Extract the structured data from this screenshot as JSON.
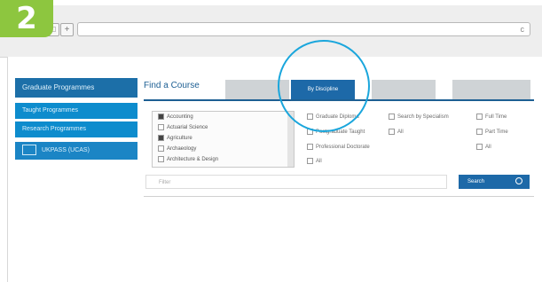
{
  "step": {
    "number": "2"
  },
  "browser": {
    "nav": [
      {
        "icon": "square-button-icon",
        "glyph": "□"
      },
      {
        "icon": "plus-icon",
        "glyph": "+"
      }
    ],
    "reload": {
      "icon": "reload-icon",
      "glyph": "c"
    }
  },
  "sidebar": {
    "header": "Graduate Programmes",
    "items": [
      "Taught Programmes",
      "Research Programmes"
    ],
    "ucas": {
      "label": "UKPASS (UCAS)",
      "icon": "ucas-logo-icon"
    }
  },
  "finder": {
    "title": "Find a Course",
    "tabs": [
      {
        "label": "",
        "active": false
      },
      {
        "label": "By Discipline",
        "active": true
      },
      {
        "label": "",
        "active": false
      },
      {
        "label": "",
        "active": false
      }
    ],
    "subjects": [
      {
        "label": "Accounting",
        "checked": true
      },
      {
        "label": "Actuarial Science",
        "checked": false
      },
      {
        "label": "Agriculture",
        "checked": true
      },
      {
        "label": "Archaeology",
        "checked": false
      },
      {
        "label": "Architecture & Design",
        "checked": false
      }
    ],
    "options_col1": [
      "Graduate Diploma",
      "Postgraduate Taught",
      "Professional Doctorate",
      "All"
    ],
    "options_col2": [
      "Search by Specialism",
      "All"
    ],
    "options_col3": [
      "Full Time",
      "Part Time",
      "All"
    ],
    "search": {
      "placeholder": "Filter",
      "button": "Search",
      "button_icon": "search-icon"
    }
  },
  "colors": {
    "accent": "#1d69a8",
    "sidebar": "#0d8ccd",
    "badge": "#8dc63f",
    "highlight": "#1aa6dc"
  }
}
